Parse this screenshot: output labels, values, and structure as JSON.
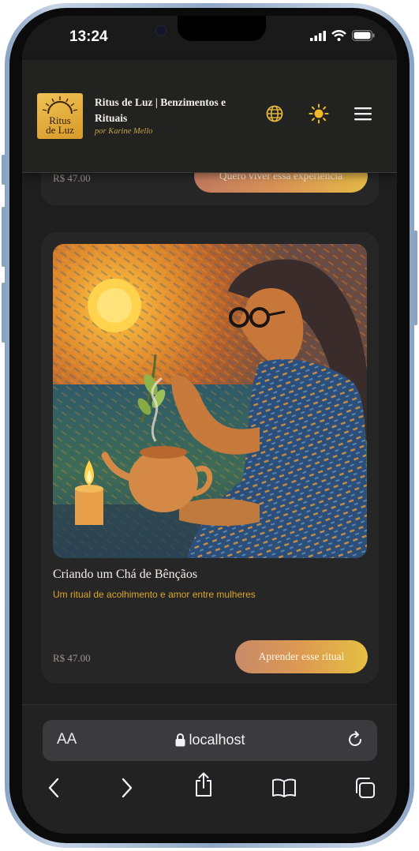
{
  "status_bar": {
    "time": "13:24"
  },
  "header": {
    "logo_line1": "Ritus",
    "logo_line2": "de Luz",
    "title": "Ritus de Luz | Benzimentos e Rituais",
    "author": "por Karine Mello",
    "icons": [
      "globe-icon",
      "sun-icon",
      "menu-icon"
    ]
  },
  "previous_card": {
    "price": "R$ 47.00",
    "button_label": "Quero viver essa experiência"
  },
  "ritual_card": {
    "title": "Criando um Chá de Bênçãos",
    "subtitle": "Um ritual de acolhimento e amor entre mulheres",
    "price": "R$ 47.00",
    "button_label": "Aprender esse ritual"
  },
  "browser": {
    "text_size_label": "AA",
    "url": "localhost",
    "icons": [
      "lock-icon",
      "reload-icon",
      "back-icon",
      "forward-icon",
      "share-icon",
      "bookmarks-icon",
      "tabs-icon"
    ]
  },
  "colors": {
    "accent": "#d9a62c",
    "background": "#1e1e1f",
    "card": "#262626"
  }
}
